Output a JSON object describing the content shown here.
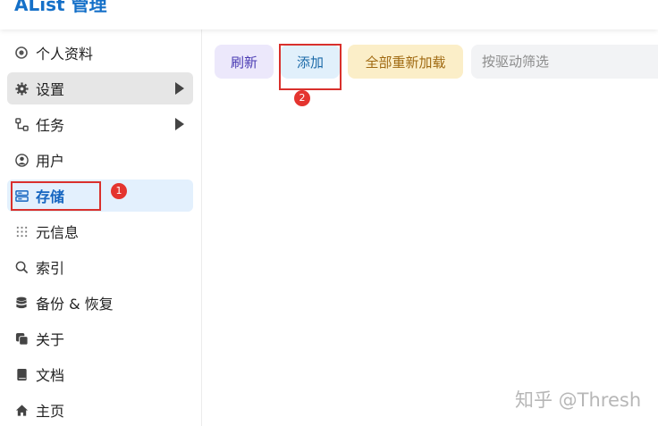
{
  "app": {
    "title": "AList 管理"
  },
  "sidebar": {
    "items": [
      {
        "label": "个人资料",
        "icon": "profile-icon"
      },
      {
        "label": "设置",
        "icon": "gear-icon",
        "expandable": true
      },
      {
        "label": "任务",
        "icon": "tasks-icon",
        "expandable": true
      },
      {
        "label": "用户",
        "icon": "user-icon"
      },
      {
        "label": "存储",
        "icon": "storage-icon",
        "active": true
      },
      {
        "label": "元信息",
        "icon": "metadata-icon"
      },
      {
        "label": "索引",
        "icon": "search-icon"
      },
      {
        "label": "备份 & 恢复",
        "icon": "database-icon"
      },
      {
        "label": "关于",
        "icon": "about-icon"
      },
      {
        "label": "文档",
        "icon": "book-icon"
      },
      {
        "label": "主页",
        "icon": "home-icon"
      }
    ]
  },
  "toolbar": {
    "refresh_label": "刷新",
    "add_label": "添加",
    "reload_all_label": "全部重新加载",
    "filter_placeholder": "按驱动筛选"
  },
  "annotations": {
    "marker_1": "1",
    "marker_2": "2"
  },
  "watermark": {
    "text": "知乎 @Thresh"
  },
  "colors": {
    "brand": "#1570c8",
    "active_item_bg": "#e3f0fd",
    "annotation": "#d9302c"
  }
}
